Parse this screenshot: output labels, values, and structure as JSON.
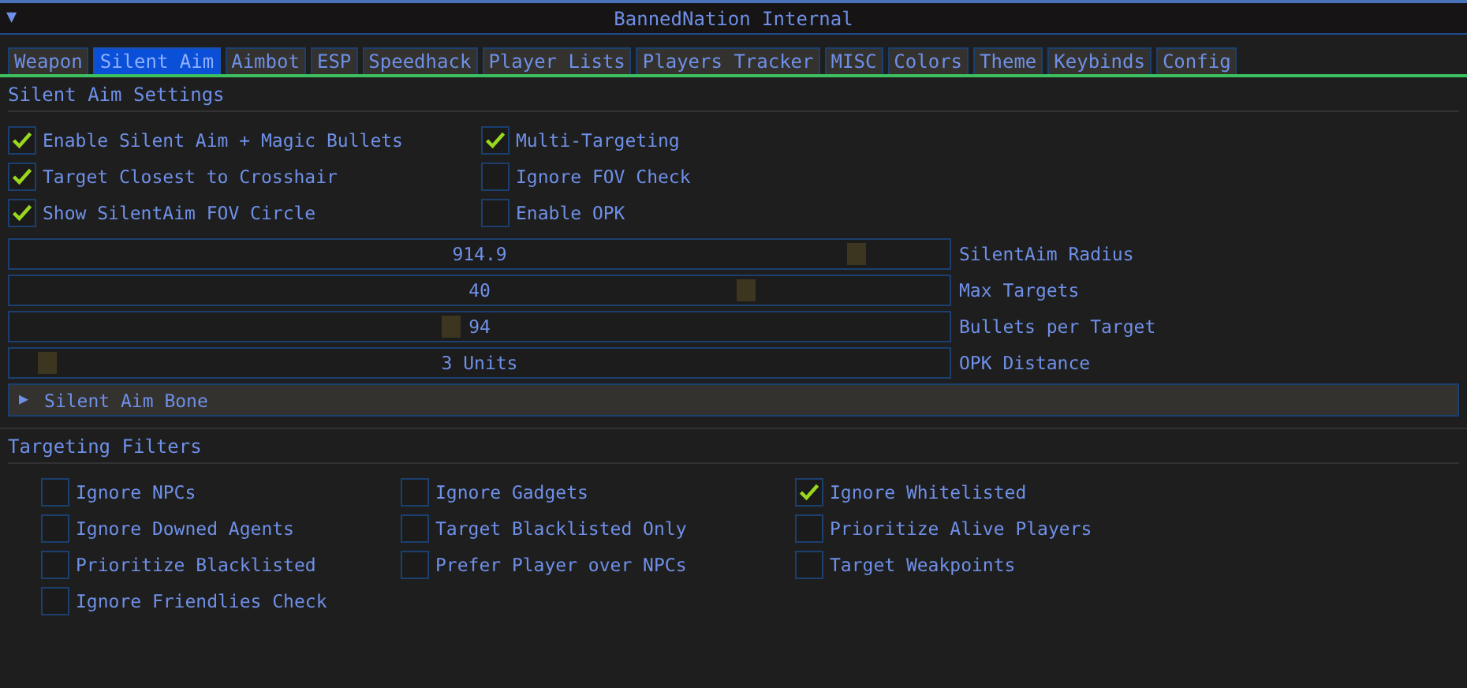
{
  "window": {
    "title": "BannedNation Internal",
    "collapse_arrow": "▼"
  },
  "tabs": [
    {
      "label": "Weapon",
      "selected": false
    },
    {
      "label": "Silent Aim",
      "selected": true
    },
    {
      "label": "Aimbot",
      "selected": false
    },
    {
      "label": "ESP",
      "selected": false
    },
    {
      "label": "Speedhack",
      "selected": false
    },
    {
      "label": "Player Lists",
      "selected": false
    },
    {
      "label": "Players Tracker",
      "selected": false
    },
    {
      "label": "MISC",
      "selected": false
    },
    {
      "label": "Colors",
      "selected": false
    },
    {
      "label": "Theme",
      "selected": false
    },
    {
      "label": "Keybinds",
      "selected": false
    },
    {
      "label": "Config",
      "selected": false
    }
  ],
  "silent_aim_settings": {
    "title": "Silent Aim Settings",
    "checkboxes": [
      {
        "label": "Enable Silent Aim + Magic Bullets",
        "checked": true
      },
      {
        "label": "Multi-Targeting",
        "checked": true
      },
      {
        "label": "Target Closest to Crosshair",
        "checked": true
      },
      {
        "label": "Ignore FOV Check",
        "checked": false
      },
      {
        "label": "Show SilentAim FOV Circle",
        "checked": true
      },
      {
        "label": "Enable OPK",
        "checked": false
      }
    ],
    "sliders": [
      {
        "label": "SilentAim Radius",
        "value": "914.9",
        "level": 0.91
      },
      {
        "label": "Max Targets",
        "value": "40",
        "level": 0.79
      },
      {
        "label": "Bullets per Target",
        "value": "94",
        "level": 0.47
      },
      {
        "label": "OPK Distance",
        "value": "3 Units",
        "level": 0.03
      }
    ],
    "bone_header": {
      "arrow": "▶",
      "label": "Silent Aim Bone",
      "expanded": false
    }
  },
  "targeting_filters": {
    "title": "Targeting Filters",
    "checkboxes": [
      {
        "label": "Ignore NPCs",
        "checked": false
      },
      {
        "label": "Ignore Gadgets",
        "checked": false
      },
      {
        "label": "Ignore Whitelisted",
        "checked": true
      },
      {
        "label": "Ignore Downed Agents",
        "checked": false
      },
      {
        "label": "Target Blacklisted Only",
        "checked": false
      },
      {
        "label": "Prioritize Alive Players",
        "checked": false
      },
      {
        "label": "Prioritize Blacklisted",
        "checked": false
      },
      {
        "label": "Prefer Player over NPCs",
        "checked": false
      },
      {
        "label": "Target Weakpoints",
        "checked": false
      },
      {
        "label": "Ignore Friendlies Check",
        "checked": false
      }
    ]
  }
}
